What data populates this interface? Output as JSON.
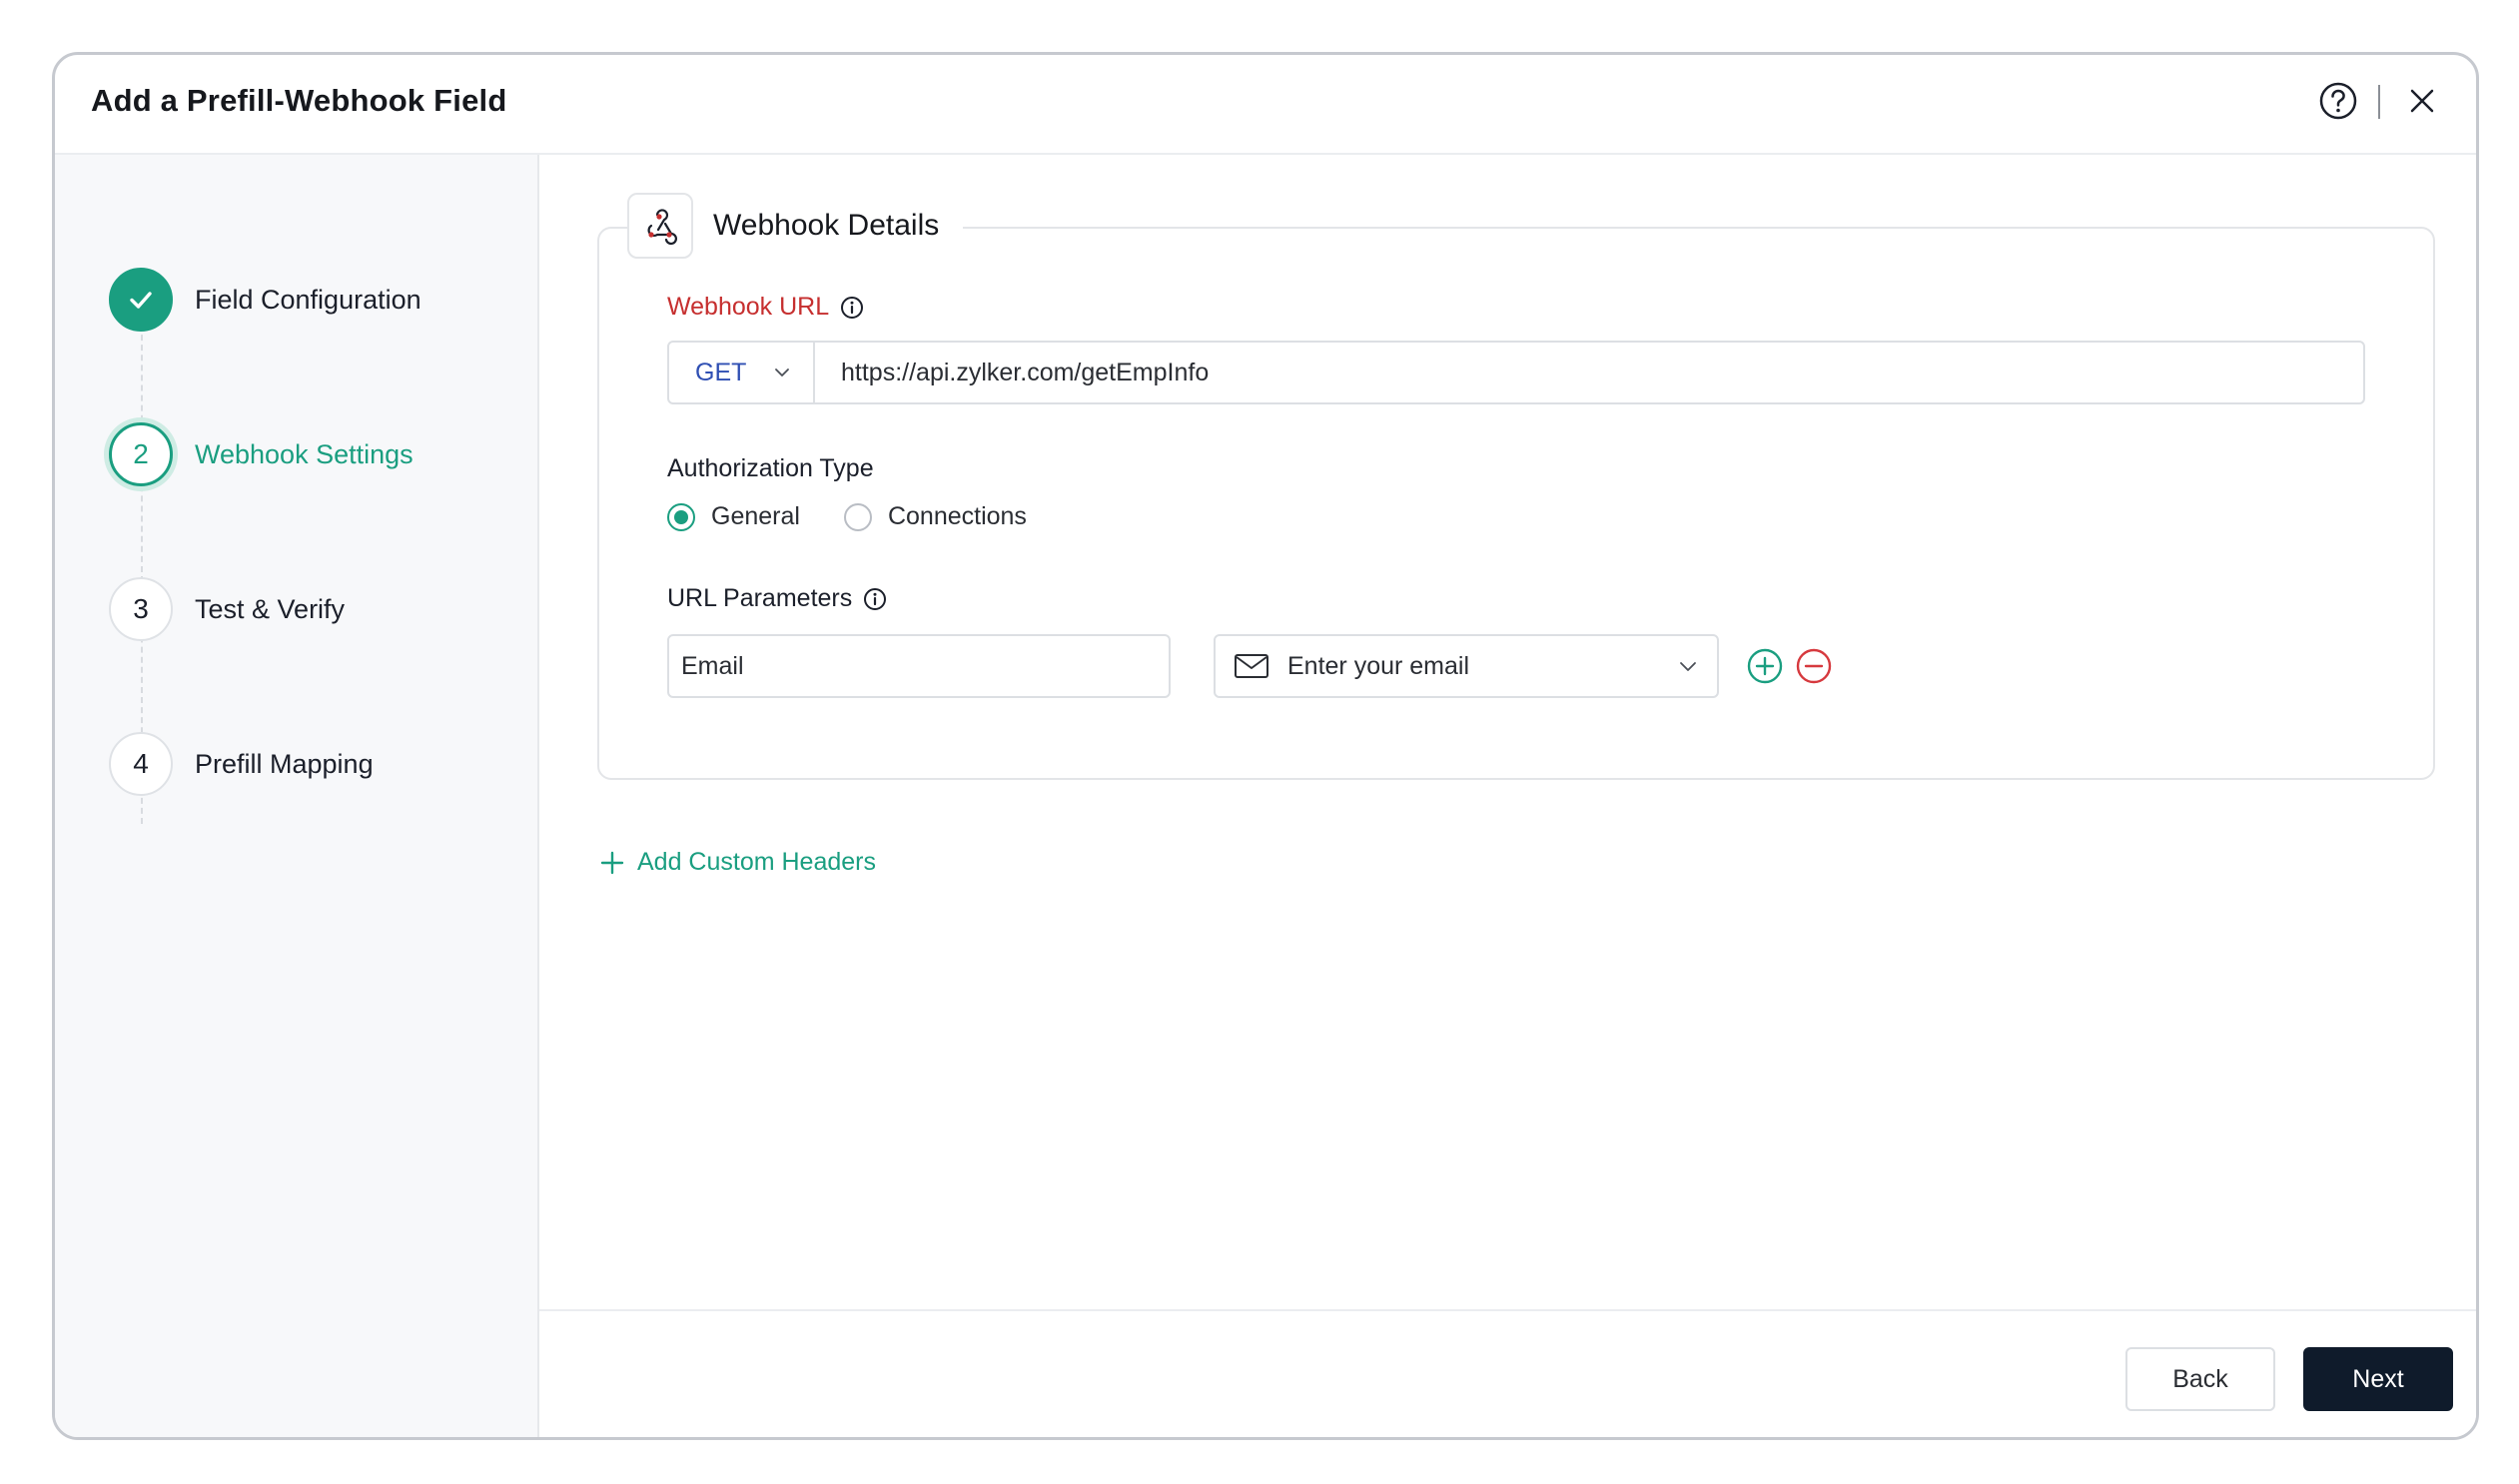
{
  "dialog": {
    "title": "Add a Prefill-Webhook Field",
    "help_icon": "question-circle-icon",
    "close_icon": "close-icon"
  },
  "steps": [
    {
      "number": "",
      "label": "Field Configuration",
      "state": "completed",
      "icon": "check-icon"
    },
    {
      "number": "2",
      "label": "Webhook Settings",
      "state": "active"
    },
    {
      "number": "3",
      "label": "Test & Verify",
      "state": "pending"
    },
    {
      "number": "4",
      "label": "Prefill Mapping",
      "state": "pending"
    }
  ],
  "webhook_details": {
    "title": "Webhook Details",
    "icon": "webhook-icon",
    "url_label": "Webhook URL",
    "method": "GET",
    "url_value": "https://api.zylker.com/getEmpInfo",
    "auth_label": "Authorization Type",
    "auth_options": [
      {
        "label": "General",
        "selected": true
      },
      {
        "label": "Connections",
        "selected": false
      }
    ],
    "params_label": "URL Parameters",
    "param_name": "Email",
    "param_value_placeholder": "Enter your email",
    "param_value_icon": "envelope-icon"
  },
  "add_headers_label": "Add Custom Headers",
  "footer": {
    "back_label": "Back",
    "next_label": "Next"
  },
  "colors": {
    "accent": "#1a9e80",
    "required": "#c62f2f",
    "method": "#2f4fb3",
    "primary_button": "#0f1b2b",
    "remove": "#d6393e"
  }
}
